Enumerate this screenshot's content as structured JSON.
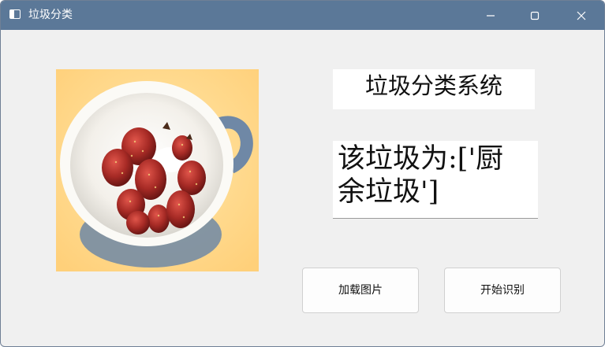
{
  "window": {
    "title": "垃圾分类",
    "title_icon": "app-window-icon",
    "titlebar_color": "#5b7898",
    "controls": [
      "minimize-icon",
      "maximize-icon",
      "close-icon"
    ]
  },
  "image_panel": {
    "subject": "strawberries-in-cup",
    "background_color": "#ffd98a"
  },
  "labels": {
    "system_title": "垃圾分类系统",
    "result_line1": "该垃圾为:['厨",
    "result_line2": "余垃圾']"
  },
  "buttons": {
    "load_image": "加载图片",
    "start_recognition": "开始识别"
  }
}
